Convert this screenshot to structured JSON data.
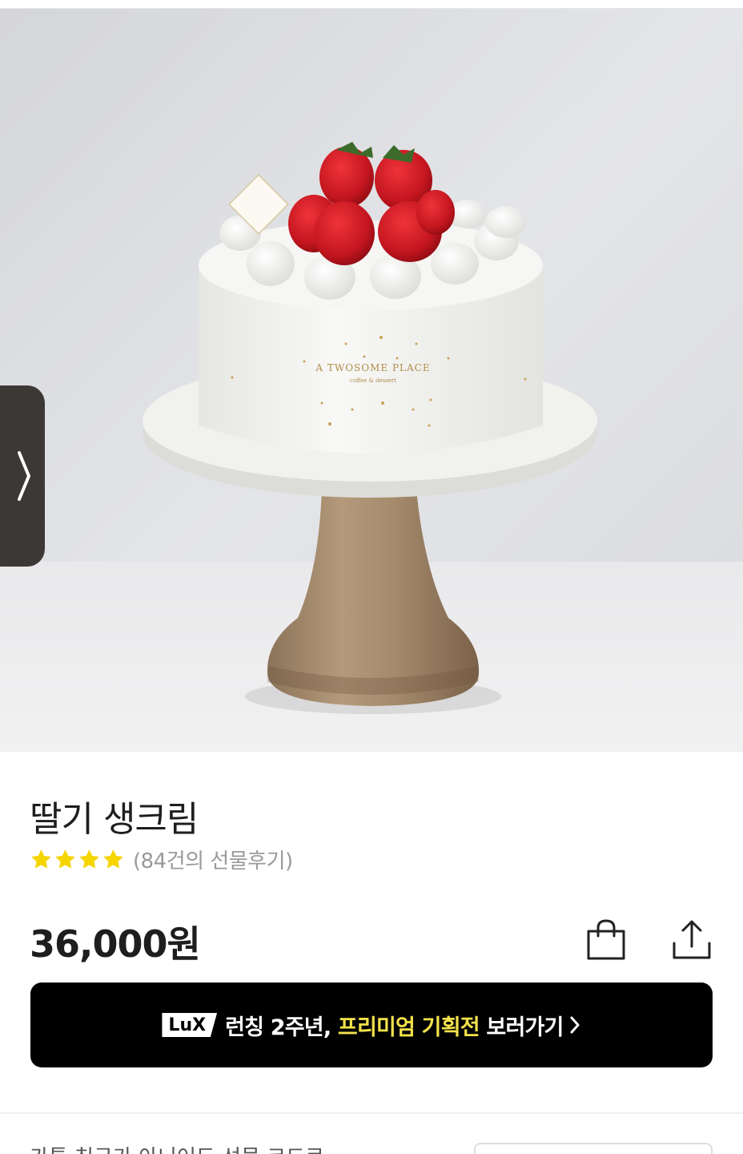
{
  "product": {
    "title": "딸기 생크림",
    "rating_stars": 4,
    "review_count_text": "(84건의 선물후기)",
    "price": "36,000원"
  },
  "image": {
    "brand_text": "A TWOSOME PLACE",
    "brand_subtext": "coffee & dessert"
  },
  "actions": {
    "cart_icon": "shopping-bag-icon",
    "share_icon": "share-icon"
  },
  "promo": {
    "badge": "LuX",
    "text_lead": "런칭 2주년,",
    "text_highlight": "프리미엄 기획전",
    "text_tail": "보러가기"
  },
  "bottom": {
    "partial_text": "카톡 친구가 아니어도 선물 코드로"
  },
  "colors": {
    "promo_bg": "#000000",
    "promo_highlight": "#f3e24a",
    "star": "#f6d500",
    "review_gray": "#9a9a9a"
  }
}
